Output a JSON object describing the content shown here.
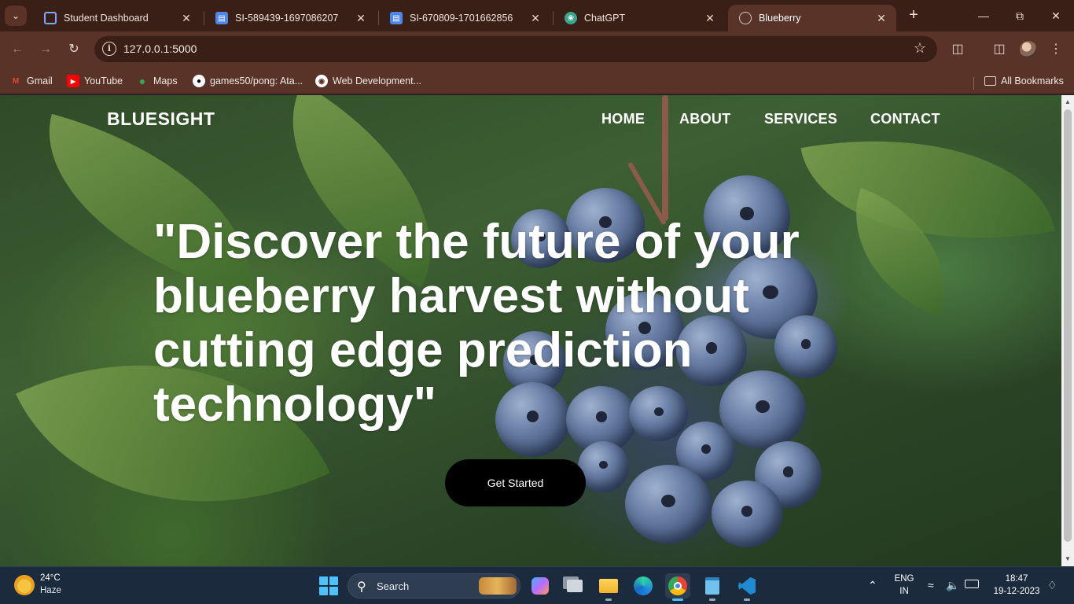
{
  "browser": {
    "tabs": [
      {
        "title": "Student Dashboard",
        "icon": "dashboard-favicon",
        "active": false
      },
      {
        "title": "SI-589439-1697086207",
        "icon": "doc-favicon",
        "active": false
      },
      {
        "title": "SI-670809-1701662856",
        "icon": "doc-favicon",
        "active": false
      },
      {
        "title": "ChatGPT",
        "icon": "chatgpt-favicon",
        "active": false
      },
      {
        "title": "Blueberry",
        "icon": "globe-favicon",
        "active": true
      }
    ],
    "url": "127.0.0.1:5000",
    "bookmarks": [
      {
        "label": "Gmail",
        "icon": "gmail-icon"
      },
      {
        "label": "YouTube",
        "icon": "youtube-icon"
      },
      {
        "label": "Maps",
        "icon": "maps-icon"
      },
      {
        "label": "games50/pong: Ata...",
        "icon": "github-icon"
      },
      {
        "label": "Web Development...",
        "icon": "site-icon"
      }
    ],
    "all_bookmarks": "All Bookmarks"
  },
  "page": {
    "logo": "BLUESIGHT",
    "nav": [
      "HOME",
      "ABOUT",
      "SERVICES",
      "CONTACT"
    ],
    "hero_lines": [
      "\"Discover the future of your",
      "blueberry harvest without",
      "cutting edge prediction",
      "technology\""
    ],
    "cta": "Get Started"
  },
  "taskbar": {
    "weather_temp": "24°C",
    "weather_cond": "Haze",
    "search_label": "Search",
    "lang_top": "ENG",
    "lang_bottom": "IN",
    "time": "18:47",
    "date": "19-12-2023"
  },
  "colors": {
    "tabstrip": "#3a1f17",
    "toolbar": "#5a3328",
    "taskbar": "#1c2a3e",
    "windows_accent": "#4cc2ff"
  }
}
